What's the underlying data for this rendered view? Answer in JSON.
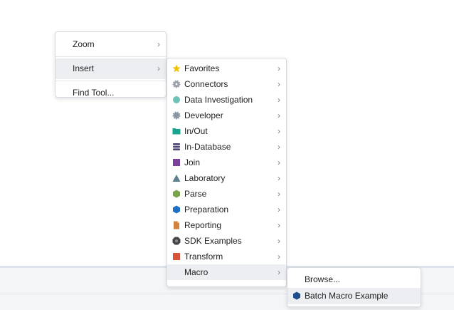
{
  "context_menu": {
    "items": [
      {
        "label": "Zoom"
      },
      {
        "label": "Insert"
      },
      {
        "label": "Find Tool..."
      }
    ]
  },
  "insert_menu": {
    "items": [
      {
        "label": "Favorites",
        "icon": "star-icon",
        "color": "#f2c200"
      },
      {
        "label": "Connectors",
        "icon": "gear-icon",
        "color": "#9aa0a8"
      },
      {
        "label": "Data Investigation",
        "icon": "circle-icon",
        "color": "#6cc1b8"
      },
      {
        "label": "Developer",
        "icon": "gear-icon",
        "color": "#8b96a3"
      },
      {
        "label": "In/Out",
        "icon": "folder-icon",
        "color": "#17a68f"
      },
      {
        "label": "In-Database",
        "icon": "database-icon",
        "color": "#4e4473"
      },
      {
        "label": "Join",
        "icon": "square-icon",
        "color": "#7a3f98"
      },
      {
        "label": "Laboratory",
        "icon": "triangle-icon",
        "color": "#5a7f8e"
      },
      {
        "label": "Parse",
        "icon": "hexagon-icon",
        "color": "#7aa24a"
      },
      {
        "label": "Preparation",
        "icon": "hexagon-icon",
        "color": "#1f6fc4"
      },
      {
        "label": "Reporting",
        "icon": "document-icon",
        "color": "#d3823b"
      },
      {
        "label": "SDK Examples",
        "icon": "octagon-icon",
        "color": "#45464a"
      },
      {
        "label": "Transform",
        "icon": "square-icon",
        "color": "#d9553a"
      },
      {
        "label": "Macro",
        "icon": "",
        "color": ""
      }
    ]
  },
  "macro_menu": {
    "items": [
      {
        "label": "Browse..."
      },
      {
        "label": "Batch Macro Example",
        "icon": "hexagon-icon",
        "color": "#1e4f8c"
      }
    ]
  },
  "colors": {
    "highlight": "#eceef2",
    "menu_border": "#d6dbe1"
  }
}
